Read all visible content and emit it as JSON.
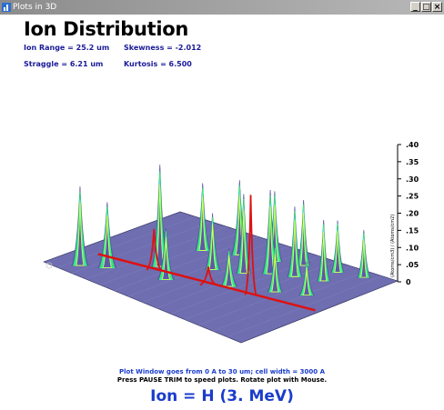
{
  "window": {
    "title": "Plots in 3D",
    "min_label": "_",
    "max_label": "□",
    "close_label": "×"
  },
  "header": {
    "title": "Ion Distribution",
    "ion_range": "Ion Range = 25.2 um",
    "skewness": "Skewness = -2.012",
    "straggle": "Straggle = 6.21 um",
    "kurtosis": "Kurtosis = 6.500"
  },
  "footer": {
    "window_info": "Plot Window goes from 0 A to 30 um;  cell width = 3000 A",
    "hint": "Press PAUSE TRIM to speed plots.   Rotate plot with Mouse.",
    "ion": "Ion =  H (3. MeV)"
  },
  "chart_data": {
    "type": "area",
    "zlabel": "(Atoms/cm3) / (Atoms/cm2)",
    "zlim": [
      0,
      0.4
    ],
    "zticks": [
      ".40",
      ".35",
      ".30",
      ".25",
      ".20",
      ".15",
      ".10",
      ".05",
      "0"
    ],
    "colors": {
      "surface": "#5a5aa8",
      "floor": "#6e6eb0",
      "mesh_high": "#33ff66",
      "mesh_peak": "#ffff33",
      "profile": "#dd1111"
    }
  }
}
